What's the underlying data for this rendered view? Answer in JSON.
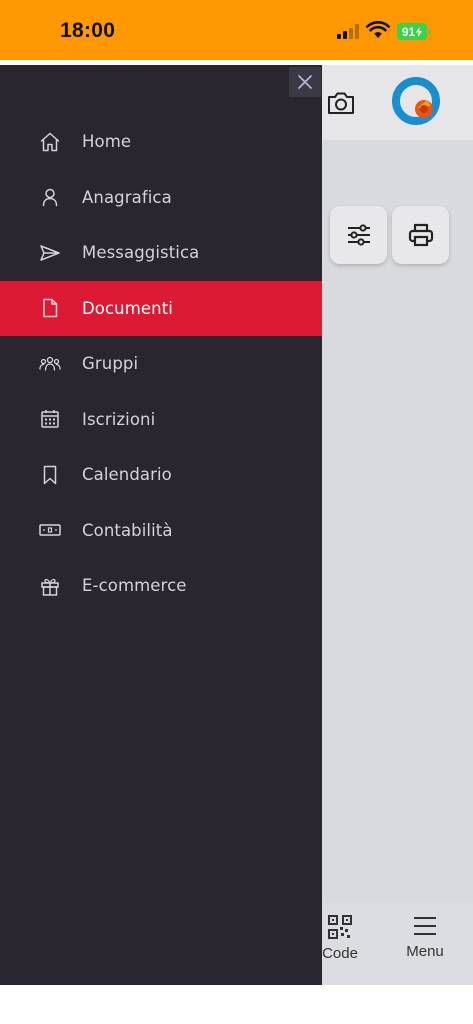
{
  "status_bar": {
    "time": "18:00",
    "battery": "91"
  },
  "colors": {
    "status_bar_bg": "#fd9802",
    "drawer_bg": "#29262f",
    "active_item_bg": "#dc1a33",
    "menu_text": "#d4d2da"
  },
  "drawer": {
    "close_icon": "close-icon",
    "items": [
      {
        "label": "Home",
        "icon": "home-icon",
        "active": false
      },
      {
        "label": "Anagrafica",
        "icon": "user-icon",
        "active": false
      },
      {
        "label": "Messaggistica",
        "icon": "send-icon",
        "active": false
      },
      {
        "label": "Documenti",
        "icon": "document-icon",
        "active": true
      },
      {
        "label": "Gruppi",
        "icon": "group-icon",
        "active": false
      },
      {
        "label": "Iscrizioni",
        "icon": "calendar-grid-icon",
        "active": false
      },
      {
        "label": "Calendario",
        "icon": "bookmark-icon",
        "active": false
      },
      {
        "label": "Contabilità",
        "icon": "cash-icon",
        "active": false
      },
      {
        "label": "E-commerce",
        "icon": "gift-icon",
        "active": false
      }
    ]
  },
  "app": {
    "tab_bar": {
      "qr_label": "Code",
      "menu_label": "Menu"
    }
  }
}
